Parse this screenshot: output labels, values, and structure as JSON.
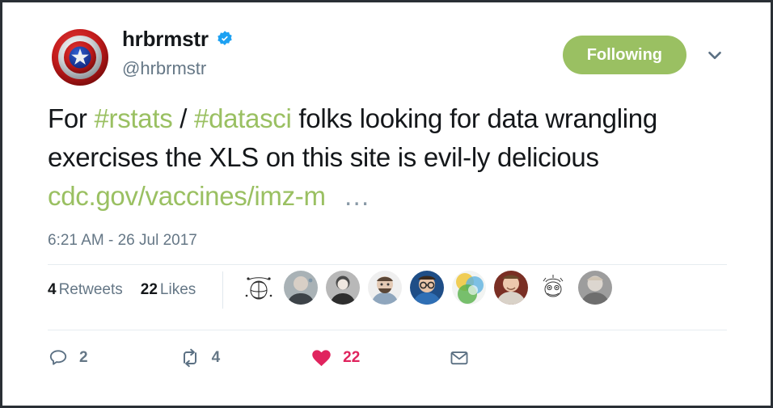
{
  "tweet": {
    "author": {
      "display_name": "hrbrmstr",
      "handle": "@hrbrmstr",
      "verified_badge": "verified-icon",
      "avatar": "captain-america-shield-avatar"
    },
    "follow_button": {
      "label": "Following",
      "color": "#9ac062"
    },
    "caret_icon": "chevron-down-icon",
    "text": {
      "segment_1": "For ",
      "hashtag_1": "#rstats",
      "segment_2": " / ",
      "hashtag_2": "#datasci",
      "segment_3": " folks looking for data wrangling exercises the XLS on this site is evil-ly delicious ",
      "link": "cdc.gov/vaccines/imz-m",
      "ellipsis": "…"
    },
    "timestamp": "6:21 AM - 26 Jul 2017",
    "stats": {
      "retweets_count": "4",
      "retweets_label": "Retweets",
      "likes_count": "22",
      "likes_label": "Likes"
    },
    "likers": [
      {
        "name": "liker-avatar-sketch-balloon",
        "type": "line-drawing"
      },
      {
        "name": "liker-avatar-man-bald",
        "type": "photo"
      },
      {
        "name": "liker-avatar-person-bw",
        "type": "photo"
      },
      {
        "name": "liker-avatar-man-beard",
        "type": "photo"
      },
      {
        "name": "liker-avatar-man-glasses",
        "type": "photo"
      },
      {
        "name": "liker-avatar-colorful-abstract",
        "type": "graphic"
      },
      {
        "name": "liker-avatar-man-smiling",
        "type": "photo"
      },
      {
        "name": "liker-avatar-sketch-face",
        "type": "line-drawing"
      },
      {
        "name": "liker-avatar-man-young",
        "type": "photo"
      }
    ],
    "actions": {
      "reply": {
        "icon": "reply-icon",
        "count": "2"
      },
      "retweet": {
        "icon": "retweet-icon",
        "count": "4"
      },
      "like": {
        "icon": "heart-filled-icon",
        "count": "22",
        "color": "#e0245e"
      },
      "message": {
        "icon": "envelope-icon",
        "count": ""
      }
    }
  }
}
